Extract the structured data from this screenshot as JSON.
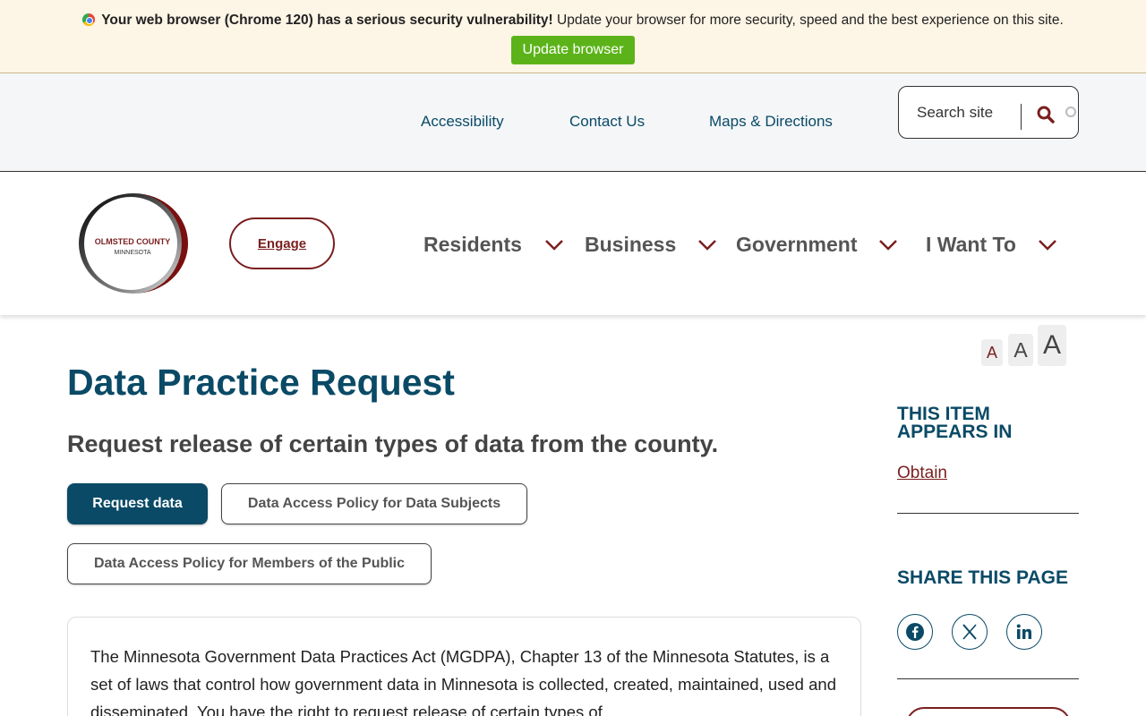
{
  "banner": {
    "bold_text": "Your web browser (Chrome 120) has a serious security vulnerability!",
    "text": " Update your browser for more security, speed and the best experience on this site.",
    "button_label": "Update browser",
    "accent_color": "#5cb319"
  },
  "utility_nav": {
    "links": [
      "Accessibility",
      "Contact Us",
      "Maps & Directions"
    ],
    "search_placeholder": "Search site"
  },
  "header": {
    "logo_text_line1": "OLMSTED COUNTY",
    "logo_text_line2": "MINNESOTA",
    "engage_label": "Engage",
    "nav": [
      "Residents",
      "Business",
      "Government",
      "I Want To"
    ]
  },
  "font_sizer": {
    "small": "A",
    "medium": "A",
    "large": "A"
  },
  "page": {
    "title": "Data Practice Request",
    "subtitle": "Request release of certain types of data from the county.",
    "buttons": {
      "primary": "Request data",
      "policy_subjects": "Data Access Policy for Data Subjects",
      "policy_public": "Data Access Policy for Members of the Public"
    },
    "body": "The Minnesota Government Data Practices Act (MGDPA), Chapter 13 of the Minnesota Statutes, is a set of laws that control how government data in Minnesota is collected, created, maintained, used and disseminated. You have the right to request release of certain types of"
  },
  "sidebar": {
    "appears_in_line1": "THIS ITEM",
    "appears_in_line2": "APPEARS IN",
    "appears_in_link": "Obtain",
    "share_heading": "SHARE THIS PAGE",
    "share_icons": [
      "facebook-icon",
      "x-icon",
      "linkedin-icon"
    ]
  },
  "colors": {
    "primary": "#0a4a66",
    "brand_red": "#7a1f1f",
    "banner_bg": "#fdf5e6"
  }
}
